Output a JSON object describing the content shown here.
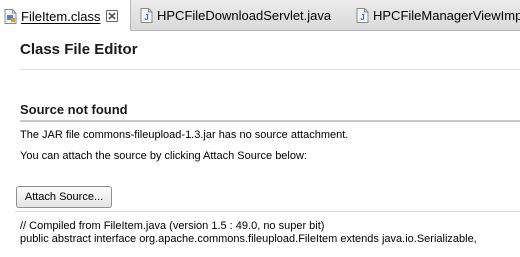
{
  "tabs": [
    {
      "label": "FileItem.class",
      "active": true,
      "icon": "class-file-icon"
    },
    {
      "label": "HPCFileDownloadServlet.java",
      "active": false,
      "icon": "java-file-icon"
    },
    {
      "label": "HPCFileManagerViewImp",
      "active": false,
      "icon": "java-file-icon"
    }
  ],
  "editor": {
    "title": "Class File Editor",
    "source_section_title": "Source not found",
    "message_line1": "The JAR file commons-fileupload-1.3.jar has no source attachment.",
    "message_line2": "You can attach the source by clicking Attach Source below:",
    "attach_button_label": "Attach Source...",
    "code_line1": "// Compiled from FileItem.java (version 1.5 : 49.0, no super bit)",
    "code_line2": "public abstract interface org.apache.commons.fileupload.FileItem extends java.io.Serializable,"
  },
  "colors": {
    "java_icon_blue": "#3c6bb8",
    "class_icon_accent": "#c9a227"
  }
}
